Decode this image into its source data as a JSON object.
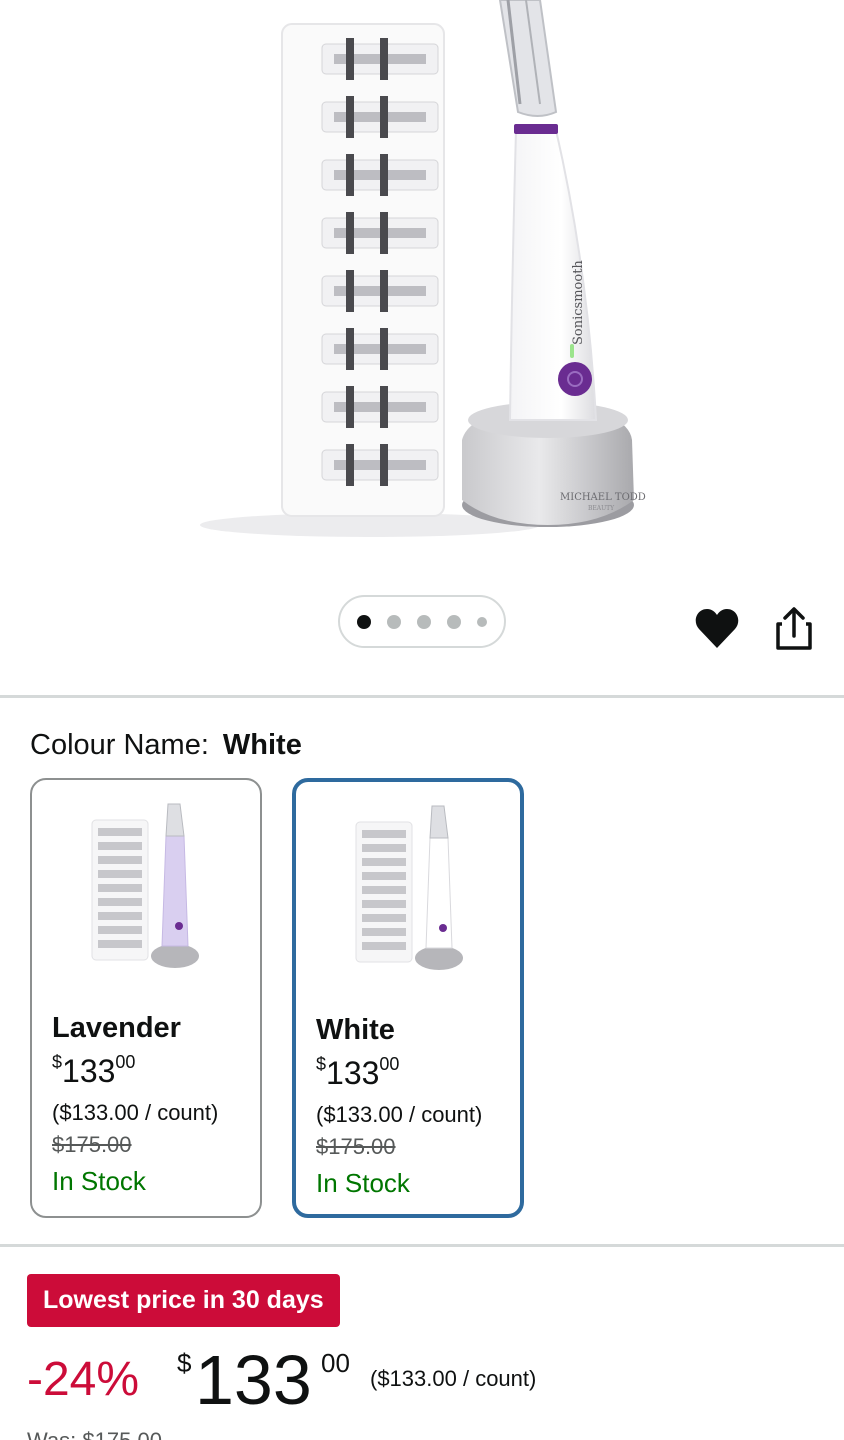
{
  "product_image": {
    "alt": "Sonicsmooth dermaplaning device with blade refill tray",
    "device_label": "Sonicsmooth",
    "base_label": "MICHAEL TODD",
    "base_sublabel": "BEAUTY"
  },
  "carousel": {
    "total": 5,
    "active_index": 0
  },
  "actions": {
    "wishlist_icon": "heart-icon",
    "share_icon": "share-icon"
  },
  "colour": {
    "label": "Colour Name:",
    "selected": "White"
  },
  "swatches": [
    {
      "name": "Lavender",
      "price_symbol": "$",
      "price_whole": "133",
      "price_fraction": "00",
      "unit_price": "($133.00 / count)",
      "was_price": "$175.00",
      "stock": "In Stock",
      "handle_color": "#d9cff0"
    },
    {
      "name": "White",
      "price_symbol": "$",
      "price_whole": "133",
      "price_fraction": "00",
      "unit_price": "($133.00 / count)",
      "was_price": "$175.00",
      "stock": "In Stock",
      "handle_color": "#ffffff"
    }
  ],
  "deal": {
    "badge": "Lowest price in 30 days",
    "discount": "-24%",
    "price_symbol": "$",
    "price_whole": "133",
    "price_fraction": "00",
    "unit_price": "($133.00 / count)",
    "was_label": "Was: $175.00"
  },
  "colors": {
    "deal_red": "#cc0c39",
    "stock_green": "#007600",
    "selected_border": "#2e6a9e",
    "accent_purple": "#6a2c91"
  }
}
